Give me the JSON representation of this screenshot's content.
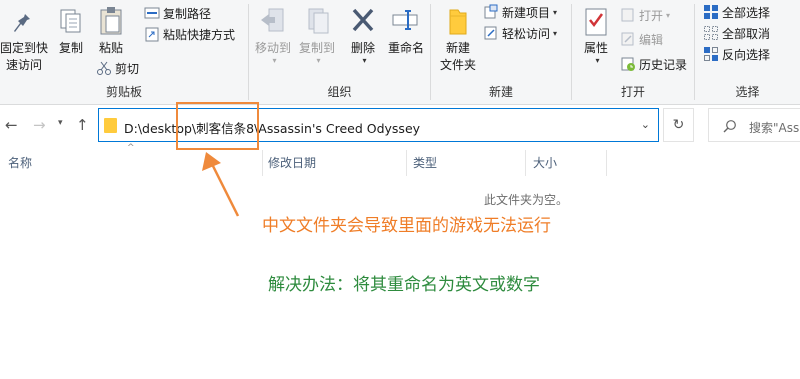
{
  "ribbon": {
    "clipboard": {
      "pin_label": "固定到快速访问",
      "copy_label": "复制",
      "paste_label": "粘贴",
      "copy_path_label": "复制路径",
      "paste_shortcut_label": "粘贴快捷方式",
      "cut_label": "剪切",
      "group_label": "剪贴板"
    },
    "organize": {
      "move_to_label": "移动到",
      "copy_to_label": "复制到",
      "delete_label": "删除",
      "rename_label": "重命名",
      "group_label": "组织"
    },
    "new": {
      "new_folder_label": "新建\n文件夹",
      "new_item_label": "新建项目",
      "easy_access_label": "轻松访问",
      "group_label": "新建"
    },
    "open": {
      "properties_label": "属性",
      "open_label": "打开",
      "edit_label": "编辑",
      "history_label": "历史记录",
      "group_label": "打开"
    },
    "select": {
      "select_all_label": "全部选择",
      "select_none_label": "全部取消",
      "invert_label": "反向选择",
      "group_label": "选择"
    }
  },
  "address": {
    "path": "D:\\desktop\\刺客信条8\\Assassin's Creed Odyssey",
    "search_placeholder": "搜索\"Assa"
  },
  "columns": [
    "名称",
    "修改日期",
    "类型",
    "大小"
  ],
  "empty_text": "此文件夹为空。",
  "annotations": {
    "note1": "中文文件夹会导致里面的游戏无法运行",
    "note2": "解决办法：将其重命名为英文或数字"
  },
  "colors": {
    "accent": "#0078d7",
    "annotation_orange": "#ef7d27",
    "annotation_green": "#2e8b3e"
  }
}
